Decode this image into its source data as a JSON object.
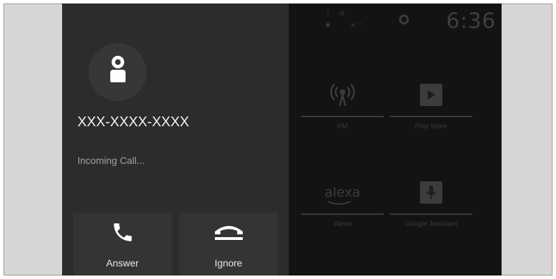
{
  "status_bar": {
    "time": "6:36"
  },
  "home_apps": [
    {
      "label": "FM",
      "icon": "radio-broadcast-icon"
    },
    {
      "label": "Play Store",
      "icon": "play-store-icon"
    },
    {
      "label": "Alexa",
      "icon": "alexa-logo-icon",
      "logo_text": "alexa"
    },
    {
      "label": "Google Assistant",
      "icon": "microphone-icon"
    }
  ],
  "call": {
    "number": "XXX-XXXX-XXXX",
    "status": "Incoming Call...",
    "answer_label": "Answer",
    "ignore_label": "Ignore"
  },
  "colors": {
    "panel": "#2c2c2c",
    "button": "#343434",
    "background": "#131313",
    "text": "#f2f2f2"
  }
}
